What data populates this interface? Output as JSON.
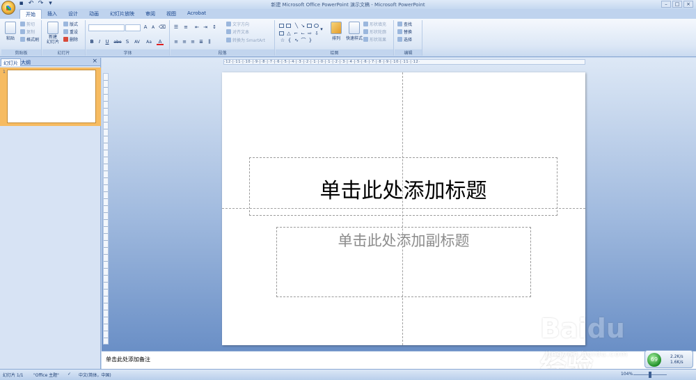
{
  "window": {
    "title": "新建 Microsoft Office PowerPoint 演示文稿 - Microsoft PowerPoint"
  },
  "tabs": [
    "开始",
    "插入",
    "设计",
    "动画",
    "幻灯片放映",
    "审阅",
    "视图",
    "Acrobat"
  ],
  "ribbon": {
    "clipboard": {
      "label": "剪贴板",
      "paste": "粘贴",
      "cut": "剪切",
      "copy": "复制",
      "format_painter": "格式刷"
    },
    "slides": {
      "label": "幻灯片",
      "new_slide": "新建\n幻灯片",
      "layout": "版式",
      "reset": "重设",
      "delete": "删除"
    },
    "font": {
      "label": "字体",
      "bold": "B",
      "italic": "I",
      "underline": "U",
      "strike": "abe",
      "shadow": "S",
      "spacing": "AV",
      "case": "Aa",
      "color": "A",
      "grow": "A",
      "shrink": "A"
    },
    "paragraph": {
      "label": "段落",
      "text_direction": "文字方向",
      "align_text": "对齐文本",
      "convert_smartart": "转换为 SmartArt"
    },
    "drawing": {
      "label": "绘图",
      "arrange": "排列",
      "quick_styles": "快速样式",
      "shape_fill": "形状填充",
      "shape_outline": "形状轮廓",
      "shape_effects": "形状效果"
    },
    "editing": {
      "label": "编辑",
      "find": "查找",
      "replace": "替换",
      "select": "选择"
    }
  },
  "left_panel": {
    "tab_slides": "幻灯片",
    "tab_outline": "大纲",
    "close": "×",
    "slide_number": "1"
  },
  "ruler": {
    "horizontal": "·12·|·11·|·10·|·9·|·8·|·7·|·6·|·5·|·4·|·3·|·2·|·1·|·0·|·1·|·2·|·3·|·4·|·5·|·6·|·7·|·8·|·9·|·10·|·11·|·12·"
  },
  "slide": {
    "title_placeholder": "单击此处添加标题",
    "subtitle_placeholder": "单击此处添加副标题"
  },
  "notes": {
    "placeholder": "单击此处添加备注"
  },
  "status": {
    "slide_count": "幻灯片 1/1",
    "theme": "\"Office 主题\"",
    "language": "中文(简体，中国)",
    "zoom": "104%"
  },
  "netmon": {
    "indicator": "69",
    "up": "2.2K/s",
    "down": "1.6K/s"
  },
  "watermark": {
    "main": "Baidu 经验",
    "sub": "jingyan.baidu.com"
  }
}
